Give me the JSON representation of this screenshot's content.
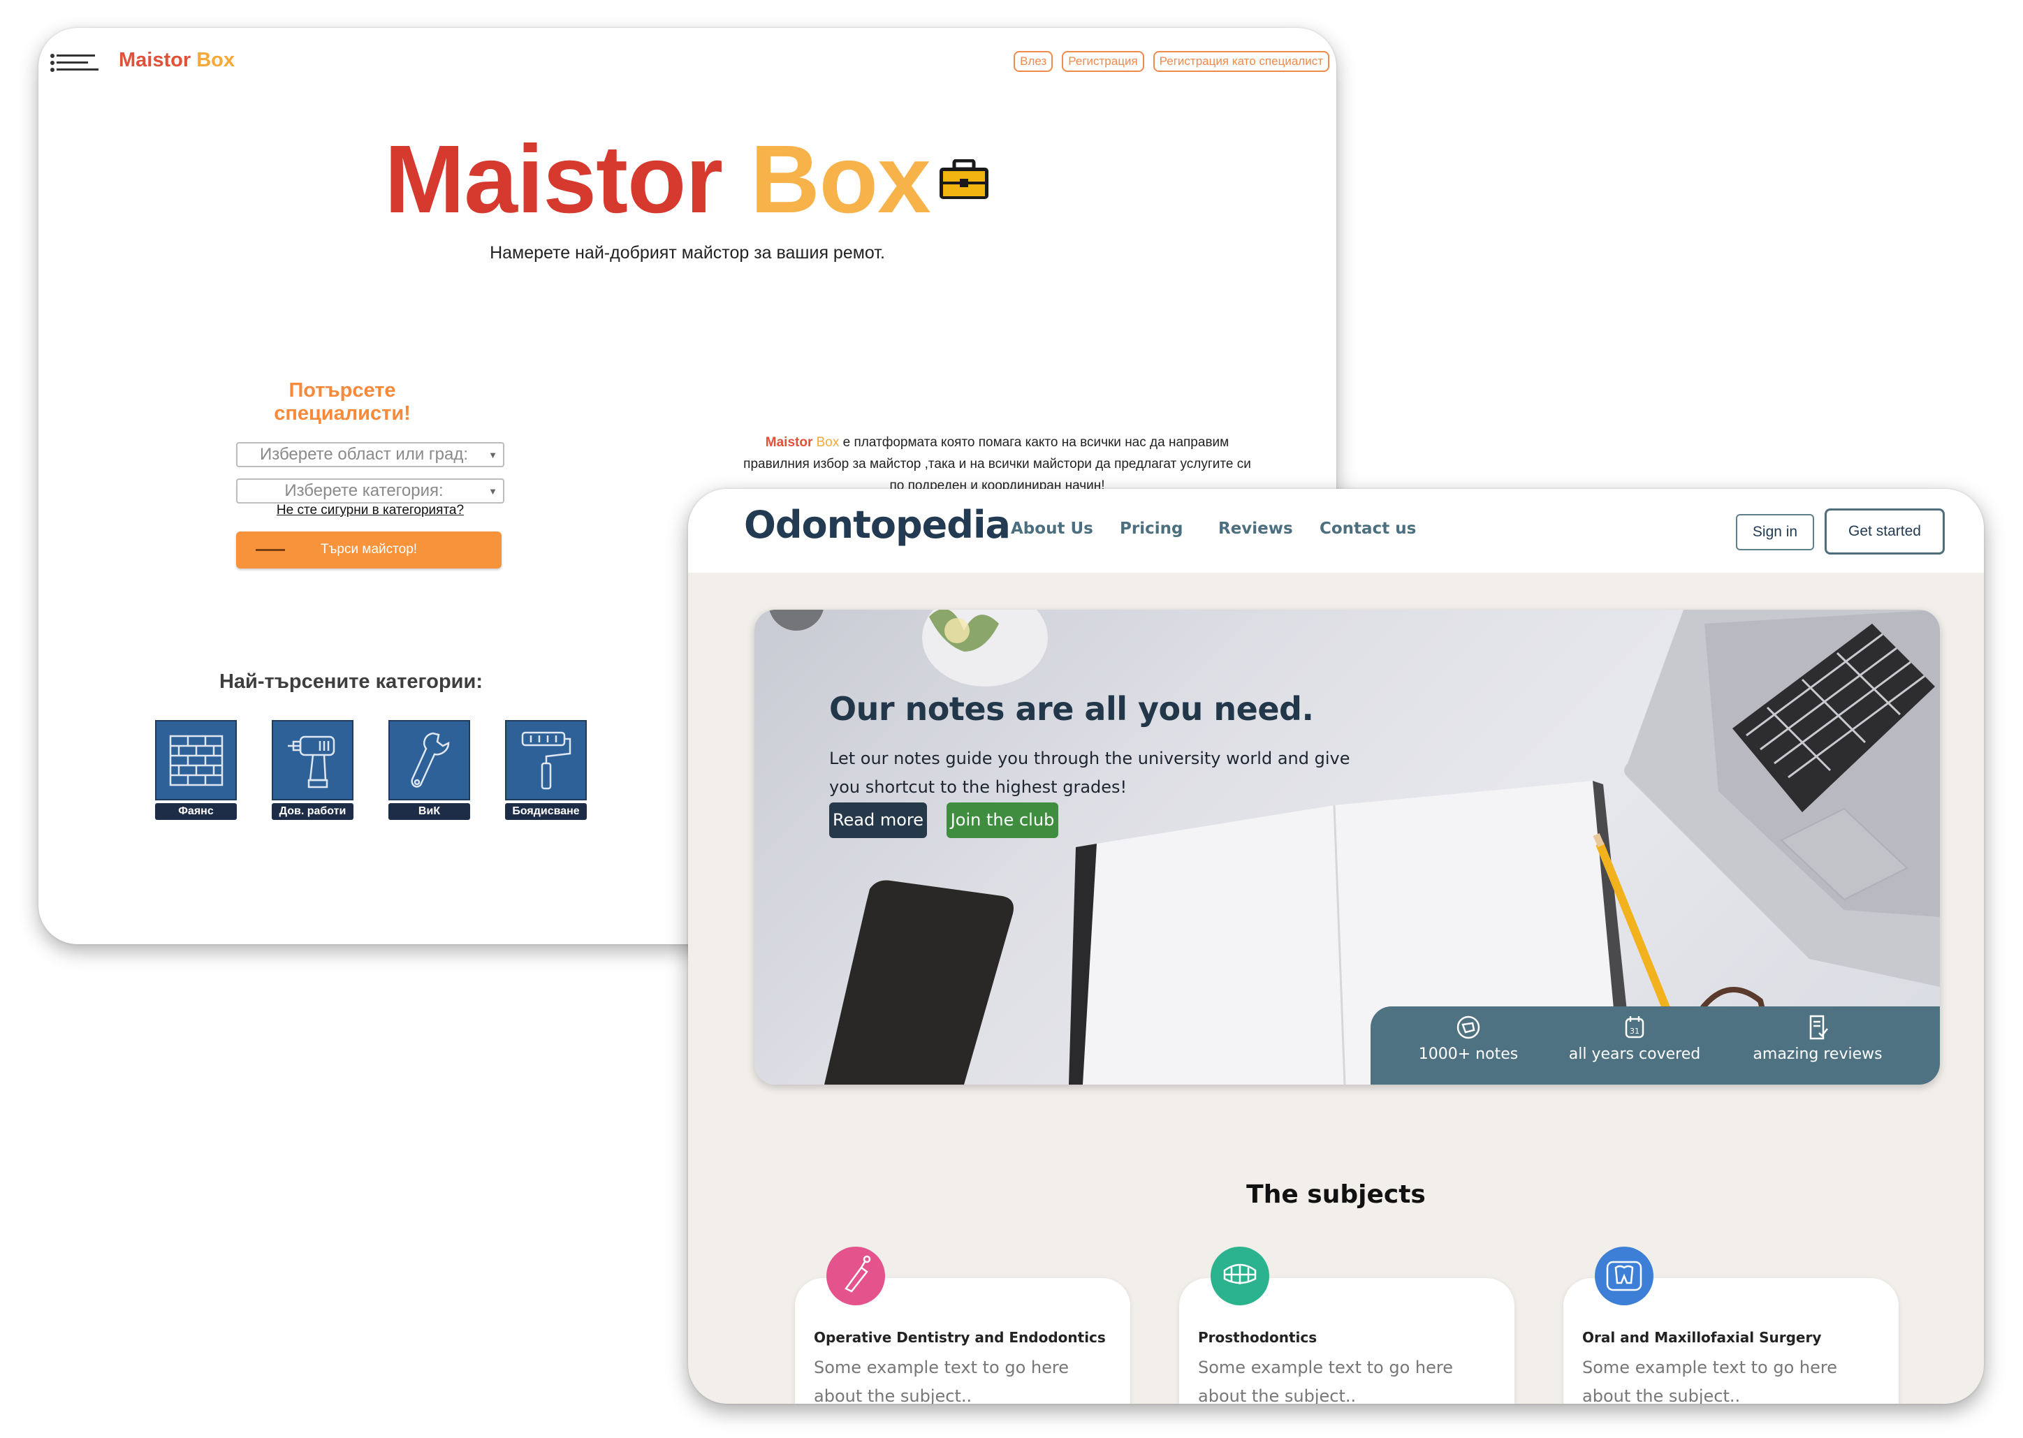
{
  "maistor": {
    "brand": {
      "first": "Maistor",
      "second": "Box"
    },
    "nav": {
      "login": "Влез",
      "register": "Регистрация",
      "register_specialist": "Регистрация като специалист"
    },
    "hero": {
      "title_first": "Maistor",
      "title_second": "Box",
      "tagline": "Намерете най-добрият майстор за вашия ремот."
    },
    "search": {
      "title": "Потърсете специалисти!",
      "area_placeholder": "Изберете област или град:",
      "category_placeholder": "Изберете категория:",
      "unsure_link": "Не сте сигурни в категорията?",
      "button": "Търси майстор!"
    },
    "about": {
      "brand_first": "Maistor",
      "brand_second": "Box",
      "text": "е платформата която помага както на всички нас да направим правилния избор за майстор ,така и на всички майстори да предлагат услугите си по подреден и координиран начин!"
    },
    "popular": {
      "title": "Най-търсените категории:",
      "items": [
        {
          "label": "Фаянс",
          "icon": "brick-wall-icon"
        },
        {
          "label": "Дов. работи",
          "icon": "drill-icon"
        },
        {
          "label": "ВиК",
          "icon": "wrench-icon"
        },
        {
          "label": "Боядисване",
          "icon": "paint-roller-icon"
        }
      ]
    },
    "colors": {
      "brand_red": "#d6392d",
      "brand_orange": "#f8b24a",
      "accent": "#f7933b",
      "tile": "#2f6199"
    }
  },
  "odonto": {
    "logo": "Odontopedia",
    "nav": [
      "About Us",
      "Pricing",
      "Reviews",
      "Contact us"
    ],
    "sign_in": "Sign in",
    "get_started": "Get started",
    "hero": {
      "title": "Our notes are all you need.",
      "text": "Let our notes guide you through the university world and give you shortcut to the highest grades!",
      "read_more": "Read more",
      "join": "Join the club"
    },
    "stats": [
      {
        "label": "1000+ notes",
        "icon": "notes-icon"
      },
      {
        "label": "all years covered",
        "icon": "calendar-icon"
      },
      {
        "label": "amazing reviews",
        "icon": "review-icon"
      }
    ],
    "subjects_title": "The subjects",
    "subjects": [
      {
        "title": "Operative Dentistry and Endodontics",
        "desc": "Some example text to go here about the subject..",
        "icon": "dental-tool-icon",
        "color": "#e4538c"
      },
      {
        "title": "Prosthodontics",
        "desc": "Some example text to go here about the subject..",
        "icon": "dentures-icon",
        "color": "#2bb38f"
      },
      {
        "title": "Oral and Maxillofaxial Surgery",
        "desc": "Some example text to go here about the subject..",
        "icon": "tooth-xray-icon",
        "color": "#3d7fd6"
      }
    ],
    "colors": {
      "navy": "#233b52",
      "slate": "#4f7282",
      "green": "#3f8e3f",
      "bg": "#f2efeb"
    }
  }
}
